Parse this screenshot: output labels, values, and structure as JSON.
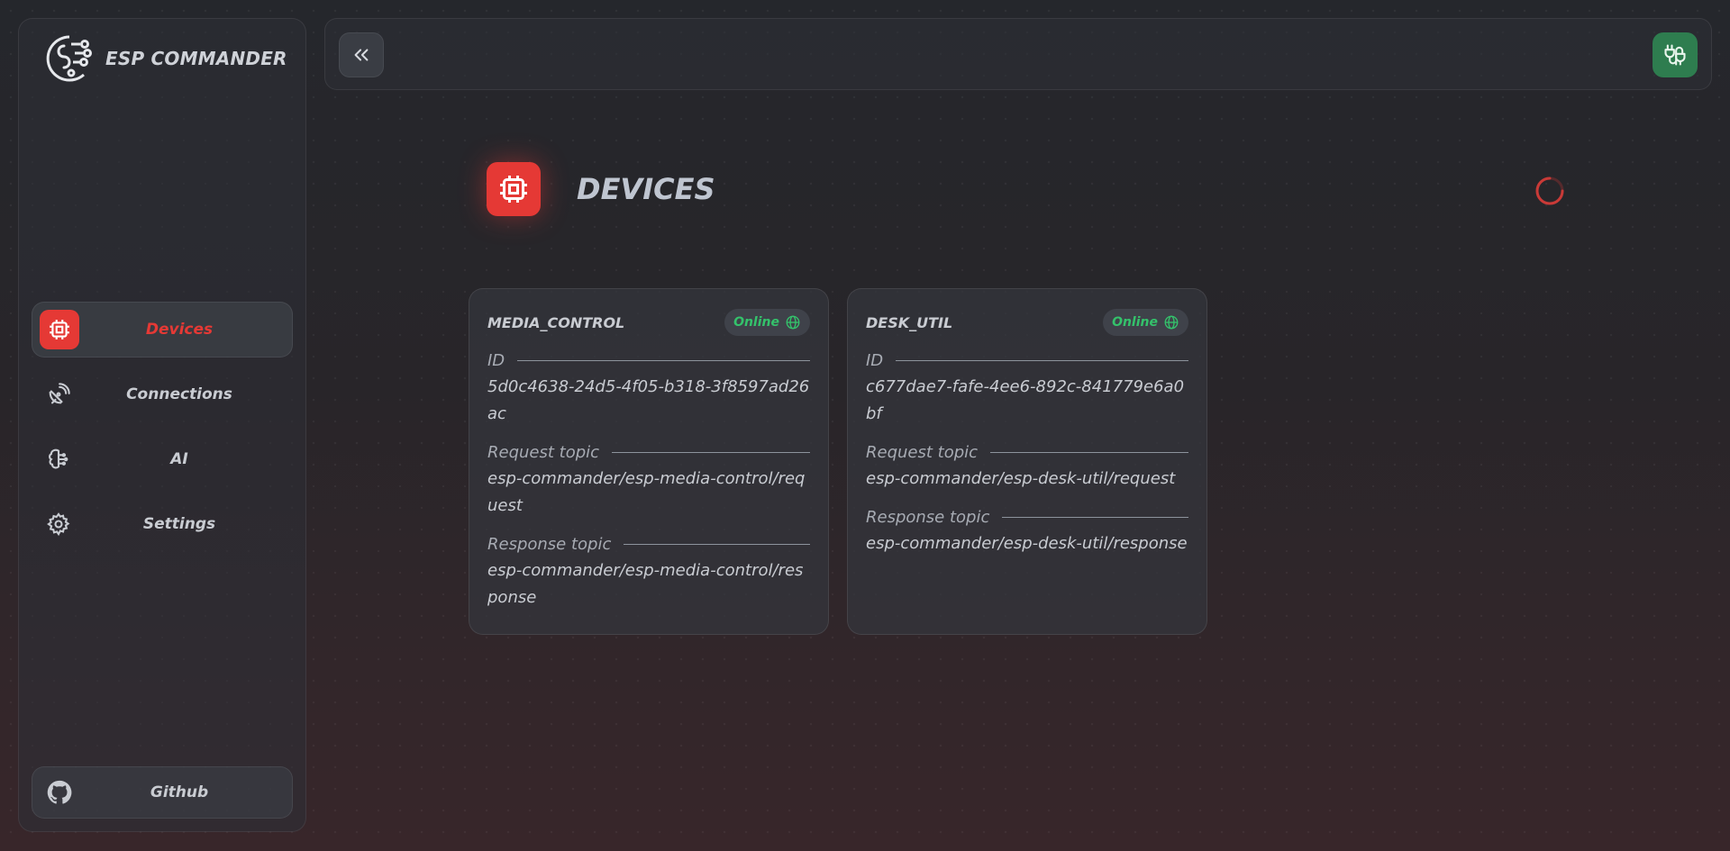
{
  "app": {
    "title": "ESP COMMANDER"
  },
  "sidebar": {
    "items": [
      {
        "label": "Devices",
        "icon": "chip-icon",
        "active": true
      },
      {
        "label": "Connections",
        "icon": "satellite-icon",
        "active": false
      },
      {
        "label": "AI",
        "icon": "brain-icon",
        "active": false
      },
      {
        "label": "Settings",
        "icon": "gear-icon",
        "active": false
      }
    ],
    "github_label": "Github"
  },
  "header": {
    "collapse_icon": "chevrons-left-icon",
    "connect_icon": "plug-icon"
  },
  "page": {
    "title": "DEVICES",
    "icon": "chip-icon"
  },
  "labels": {
    "id": "ID",
    "request_topic": "Request topic",
    "response_topic": "Response topic"
  },
  "devices": [
    {
      "name": "MEDIA_CONTROL",
      "status": "Online",
      "id": "5d0c4638-24d5-4f05-b318-3f8597ad26ac",
      "request_topic": "esp-commander/esp-media-control/request",
      "response_topic": "esp-commander/esp-media-control/response"
    },
    {
      "name": "DESK_UTIL",
      "status": "Online",
      "id": "c677dae7-fafe-4ee6-892c-841779e6a0bf",
      "request_topic": "esp-commander/esp-desk-util/request",
      "response_topic": "esp-commander/esp-desk-util/response"
    }
  ],
  "colors": {
    "accent": "#e53935",
    "online": "#34c26b",
    "connect": "#2e7d4f"
  }
}
